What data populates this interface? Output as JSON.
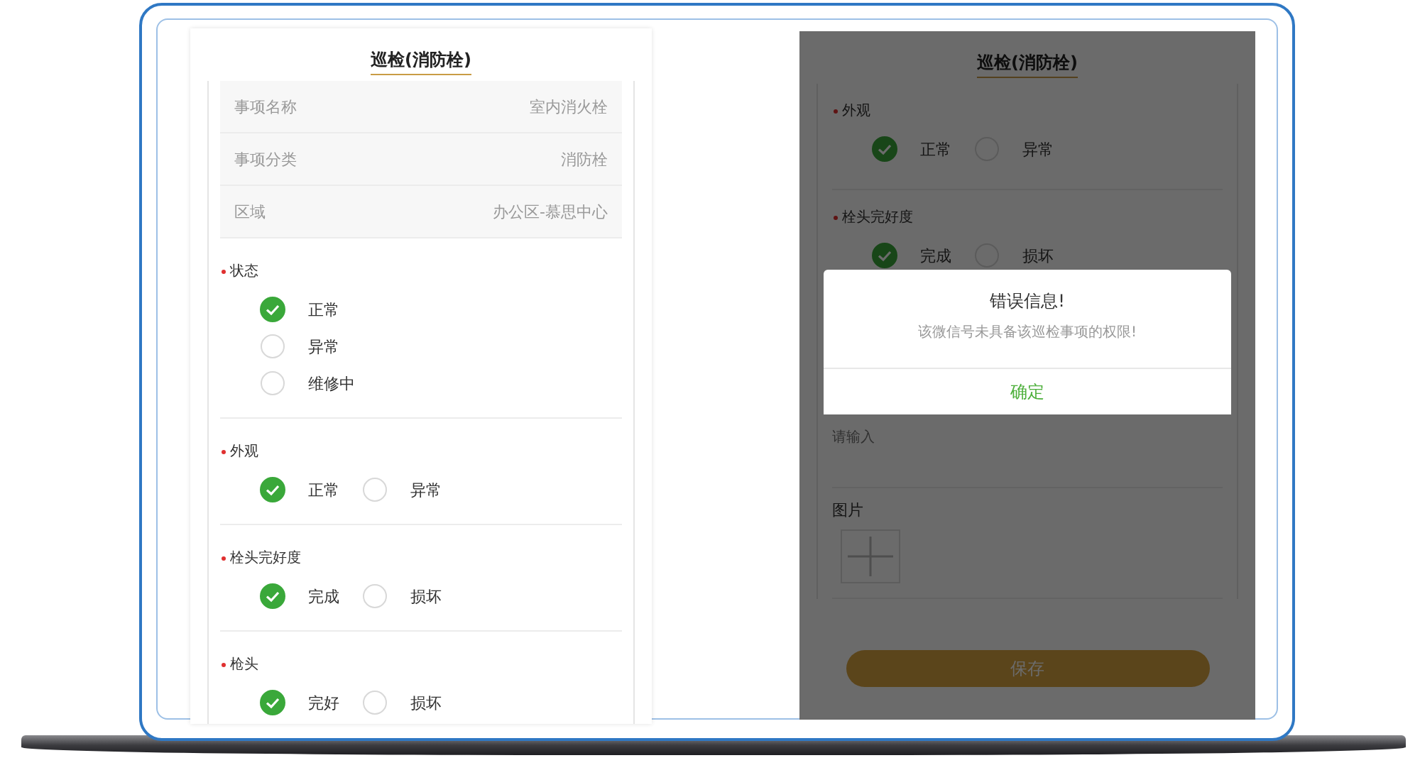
{
  "left_screen": {
    "title": "巡检(消防栓)",
    "info_rows": [
      {
        "label": "事项名称",
        "value": "室内消火栓"
      },
      {
        "label": "事项分类",
        "value": "消防栓"
      },
      {
        "label": "区域",
        "value": "办公区-慕思中心"
      }
    ],
    "questions": [
      {
        "label": "状态",
        "required": true,
        "kind": "vertical",
        "options": [
          {
            "label": "正常",
            "selected": true
          },
          {
            "label": "异常",
            "selected": false
          },
          {
            "label": "维修中",
            "selected": false
          }
        ]
      },
      {
        "label": "外观",
        "required": true,
        "kind": "horizontal",
        "options": [
          {
            "label": "正常",
            "selected": true
          },
          {
            "label": "异常",
            "selected": false
          }
        ]
      },
      {
        "label": "栓头完好度",
        "required": true,
        "kind": "horizontal",
        "options": [
          {
            "label": "完成",
            "selected": true
          },
          {
            "label": "损坏",
            "selected": false
          }
        ]
      },
      {
        "label": "枪头",
        "required": true,
        "kind": "horizontal",
        "options": [
          {
            "label": "完好",
            "selected": true
          },
          {
            "label": "损坏",
            "selected": false
          }
        ]
      }
    ]
  },
  "right_screen": {
    "title": "巡检(消防栓)",
    "questions": [
      {
        "label": "外观",
        "required": true,
        "kind": "horizontal",
        "options": [
          {
            "label": "正常",
            "selected": true
          },
          {
            "label": "异常",
            "selected": false
          }
        ]
      },
      {
        "label": "栓头完好度",
        "required": true,
        "kind": "horizontal",
        "options": [
          {
            "label": "完成",
            "selected": true
          },
          {
            "label": "损坏",
            "selected": false
          }
        ]
      }
    ],
    "remark": {
      "placeholder": "请输入"
    },
    "photos": {
      "label": "图片"
    },
    "save_button": "保存",
    "dialog": {
      "title": "错误信息!",
      "message": "该微信号未具备该巡检事项的权限!",
      "confirm": "确定"
    }
  }
}
